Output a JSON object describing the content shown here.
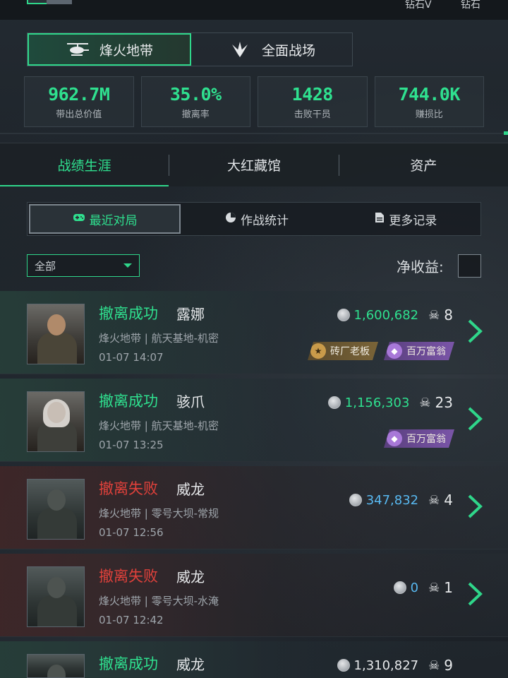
{
  "header": {
    "ranks": [
      "钻石V",
      "钻石"
    ]
  },
  "mode_tabs": [
    {
      "label": "烽火地带",
      "icon": "helicopter-icon",
      "active": true
    },
    {
      "label": "全面战场",
      "icon": "jets-icon",
      "active": false
    }
  ],
  "stats": [
    {
      "value": "962.7M",
      "label": "带出总价值"
    },
    {
      "value": "35.0%",
      "label": "撤离率"
    },
    {
      "value": "1428",
      "label": "击败干员"
    },
    {
      "value": "744.0K",
      "label": "赚损比"
    }
  ],
  "section_tabs": [
    {
      "label": "战绩生涯",
      "active": true
    },
    {
      "label": "大红藏馆",
      "active": false
    },
    {
      "label": "资产",
      "active": false
    }
  ],
  "sub_tabs": [
    {
      "label": "最近对局",
      "icon": "gamepad-icon",
      "active": true
    },
    {
      "label": "作战统计",
      "icon": "pie-chart-icon",
      "active": false
    },
    {
      "label": "更多记录",
      "icon": "document-icon",
      "active": false
    }
  ],
  "filter": {
    "selected": "全部"
  },
  "net_income": {
    "label": "净收益:"
  },
  "matches": [
    {
      "status": "撤离成功",
      "result": "ok",
      "operator": "露娜",
      "map": "烽火地带 | 航天基地-机密",
      "time": "01-07 14:07",
      "value": "1,600,682",
      "value_color": "green",
      "kills": "8",
      "badges": [
        {
          "label": "砖厂老板",
          "style": "gold"
        },
        {
          "label": "百万富翁",
          "style": "purple"
        }
      ]
    },
    {
      "status": "撤离成功",
      "result": "ok",
      "operator": "骇爪",
      "map": "烽火地带 | 航天基地-机密",
      "time": "01-07 13:25",
      "value": "1,156,303",
      "value_color": "green",
      "kills": "23",
      "badges": [
        {
          "label": "百万富翁",
          "style": "purple"
        }
      ]
    },
    {
      "status": "撤离失败",
      "result": "fail",
      "operator": "威龙",
      "map": "烽火地带 | 零号大坝-常规",
      "time": "01-07 12:56",
      "value": "347,832",
      "value_color": "blue",
      "kills": "4",
      "badges": []
    },
    {
      "status": "撤离失败",
      "result": "fail",
      "operator": "威龙",
      "map": "烽火地带 | 零号大坝-水淹",
      "time": "01-07 12:42",
      "value": "0",
      "value_color": "blue",
      "kills": "1",
      "badges": []
    },
    {
      "status": "撤离成功",
      "result": "ok",
      "operator": "威龙",
      "map": "",
      "time": "",
      "value": "1,310,827",
      "value_color": "white",
      "kills": "9",
      "badges": []
    }
  ],
  "colors": {
    "accent": "#2fd68a",
    "success": "#2fe08f",
    "fail": "#e0413b",
    "value_blue": "#58b8f0"
  }
}
